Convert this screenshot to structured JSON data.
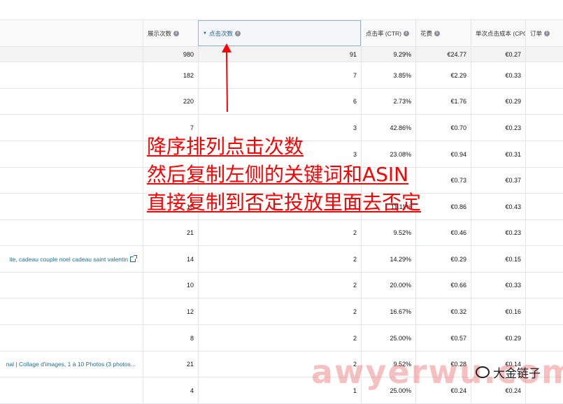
{
  "header": {
    "impressions": "展示次数",
    "clicks": "点击次数",
    "ctr": "点击率 (CTR)",
    "spend": "花费",
    "cpc": "单次点击成本 (CPC)",
    "orders": "订单"
  },
  "summary": {
    "impressions": "980",
    "clicks": "91",
    "ctr": "9.29%",
    "spend": "€24.77",
    "cpc": "€0.27"
  },
  "rows": [
    {
      "term": "",
      "impressions": "182",
      "clicks": "7",
      "ctr": "3.85%",
      "spend": "€2.29",
      "cpc": "€0.33"
    },
    {
      "term": "",
      "impressions": "220",
      "clicks": "6",
      "ctr": "2.73%",
      "spend": "€1.76",
      "cpc": "€0.29"
    },
    {
      "term": "",
      "impressions": "7",
      "clicks": "3",
      "ctr": "42.86%",
      "spend": "€0.70",
      "cpc": "€0.23"
    },
    {
      "term": "",
      "impressions": "",
      "clicks": "3",
      "ctr": "23.08%",
      "spend": "€0.94",
      "cpc": "€0.31"
    },
    {
      "term": "",
      "impressions": "",
      "clicks": "",
      "ctr": "",
      "spend": "€0.73",
      "cpc": "€0.37"
    },
    {
      "term": "",
      "impressions": "18",
      "clicks": "",
      "ctr": "11.11%",
      "spend": "€0.86",
      "cpc": "€0.43"
    },
    {
      "term": "",
      "impressions": "21",
      "clicks": "2",
      "ctr": "9.52%",
      "spend": "€0.46",
      "cpc": "€0.23"
    },
    {
      "term": "ite, cadeau couple noel cadeau saint valentin",
      "impressions": "14",
      "clicks": "2",
      "ctr": "14.29%",
      "spend": "€0.29",
      "cpc": "€0.15"
    },
    {
      "term": "",
      "impressions": "10",
      "clicks": "2",
      "ctr": "20.00%",
      "spend": "€0.66",
      "cpc": "€0.33"
    },
    {
      "term": "",
      "impressions": "12",
      "clicks": "2",
      "ctr": "16.67%",
      "spend": "€0.32",
      "cpc": "€0.16"
    },
    {
      "term": "",
      "impressions": "8",
      "clicks": "2",
      "ctr": "25.00%",
      "spend": "€0.57",
      "cpc": "€0.29"
    },
    {
      "term": "nal | Collage d'images, 1 à 10 Photos (3 photos...",
      "impressions": "21",
      "clicks": "2",
      "ctr": "9.52%",
      "spend": "€0.28",
      "cpc": "€0.14"
    },
    {
      "term": "",
      "impressions": "4",
      "clicks": "1",
      "ctr": "25.00%",
      "spend": "€0.24",
      "cpc": "€0.24"
    }
  ],
  "annotation": {
    "line1": "降序排列点击次数",
    "line2": "然后复制左侧的关键词和ASIN",
    "line3": "直接复制到否定投放里面去否定"
  },
  "watermark": {
    "text": "awyerwu.com",
    "label": "大金链子"
  },
  "colors": {
    "annotation": "#ff0000",
    "link": "#1f6f8b",
    "sorted_header": "#2162a1"
  }
}
